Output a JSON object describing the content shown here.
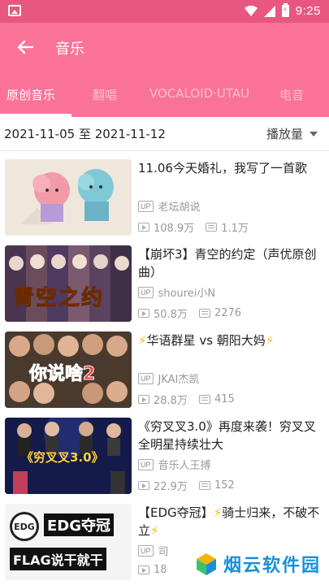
{
  "status_bar": {
    "time": "9:25"
  },
  "app_bar": {
    "title": "音乐"
  },
  "tabs": [
    {
      "label": "原创音乐"
    },
    {
      "label": "翻唱"
    },
    {
      "label": "VOCALOID·UTAU"
    },
    {
      "label": "电音"
    }
  ],
  "filter": {
    "date_range": "2021-11-05 至 2021-11-12",
    "sort_label": "播放量"
  },
  "videos": [
    {
      "title": "11.06今天婚礼，我写了一首歌",
      "uploader": "老坛胡说",
      "plays": "108.9万",
      "danmaku": "1.1万"
    },
    {
      "title": "【崩坏3】青空的约定（声优原创曲）",
      "uploader": "shourei小N",
      "plays": "50.8万",
      "danmaku": "2276"
    },
    {
      "title_parts": [
        "⚡",
        "华语群星 vs 朝阳大妈",
        "⚡"
      ],
      "uploader": "JKAI杰凯",
      "plays": "28.8万",
      "danmaku": "415"
    },
    {
      "title": "《穷叉叉3.0》再度来袭！穷叉叉全明星持续壮大",
      "uploader": "音乐人王搏",
      "plays": "22.9万",
      "danmaku": "152"
    },
    {
      "title_parts": [
        "【EDG夺冠】",
        "⚡",
        "骑士归来，不破不立",
        "⚡"
      ],
      "uploader": "司",
      "plays": "18"
    }
  ],
  "thumb_texts": {
    "t2": "青空之约",
    "t3": "你说啥2",
    "t4": "《穷叉叉3.0》",
    "t5a": "EDG夺冠",
    "t5b": "FLAG说干就干",
    "t5logo": "EDG"
  },
  "up_badge": "UP",
  "watermark": {
    "text": "烟云软件园"
  },
  "colors": {
    "status_bar": "#e8577f",
    "primary": "#fb7299",
    "accent_bolt": "#f5b800"
  }
}
